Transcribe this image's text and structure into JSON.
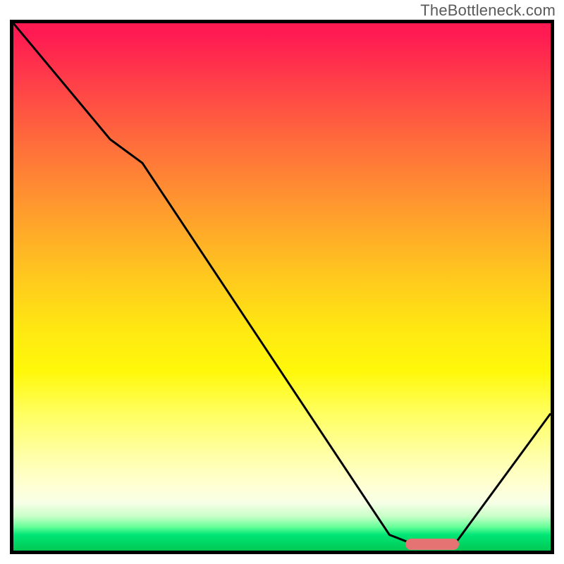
{
  "watermark": "TheBottleneck.com",
  "chart_data": {
    "type": "line",
    "title": "",
    "xlabel": "",
    "ylabel": "",
    "xlim": [
      0,
      100
    ],
    "ylim": [
      0,
      100
    ],
    "x": [
      0,
      18,
      24,
      70,
      75,
      82,
      100
    ],
    "values": [
      100,
      78,
      73.5,
      3,
      1,
      1,
      26
    ],
    "marker": {
      "x_start": 73,
      "x_end": 83,
      "y": 1.2,
      "height": 2.2
    },
    "background_gradient": {
      "top": "#ff1a52",
      "mid_upper": "#ff9a2e",
      "mid": "#ffe812",
      "mid_lower": "#ffffa8",
      "bottom": "#00c853"
    }
  },
  "frame": {
    "inner_w": 762,
    "inner_h": 748
  }
}
